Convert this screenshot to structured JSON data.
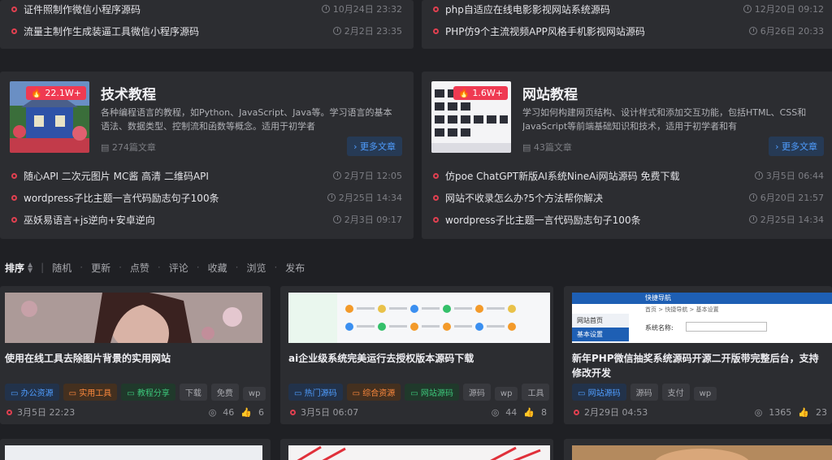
{
  "top_left": [
    {
      "title": "证件照制作微信小程序源码",
      "date": "10月24日 23:32"
    },
    {
      "title": "流量主制作生成装逼工具微信小程序源码",
      "date": "2月2日 23:35"
    }
  ],
  "top_right": [
    {
      "title": "php自适应在线电影影视网站系统源码",
      "date": "12月20日 09:12"
    },
    {
      "title": "PHP仿9个主流视频APP风格手机影视网站源码",
      "date": "6月26日 20:33"
    }
  ],
  "cat_left": {
    "hot": "22.1W+",
    "title": "技术教程",
    "desc": "各种编程语言的教程，如Python、JavaScript、Java等。学习语言的基本语法、数据类型、控制流和函数等概念。适用于初学者",
    "count": "274篇文章",
    "more": "更多文章",
    "items": [
      {
        "title": "随心API   二次元图片  MC酱  高清  二维码API",
        "date": "2月7日 12:05"
      },
      {
        "title": "wordpress子比主题一言代码励志句子100条",
        "date": "2月25日 14:34"
      },
      {
        "title": "巫妖易语言+js逆向+安卓逆向",
        "date": "2月3日 09:17"
      }
    ]
  },
  "cat_right": {
    "hot": "1.6W+",
    "title": "网站教程",
    "desc": "学习如何构建网页结构、设计样式和添加交互功能，包括HTML、CSS和JavaScript等前端基础知识和技术，适用于初学者和有",
    "count": "43篇文章",
    "more": "更多文章",
    "items": [
      {
        "title": "仿poe ChatGPT新版AI系统NineAi网站源码 免费下载",
        "date": "3月5日 06:44"
      },
      {
        "title": "网站不收录怎么办?5个方法帮你解决",
        "date": "6月20日 21:57"
      },
      {
        "title": "wordpress子比主题一言代码励志句子100条",
        "date": "2月25日 14:34"
      }
    ]
  },
  "sortbar": {
    "label": "排序",
    "options": [
      "随机",
      "更新",
      "点赞",
      "评论",
      "收藏",
      "浏览",
      "发布"
    ]
  },
  "cards": [
    {
      "title": "使用在线工具去除图片背景的实用网站",
      "tags": [
        {
          "t": "办公资源",
          "c": "blue"
        },
        {
          "t": "实用工具",
          "c": "orange"
        },
        {
          "t": "教程分享",
          "c": "green"
        },
        {
          "t": "下载",
          "c": ""
        },
        {
          "t": "免费",
          "c": ""
        },
        {
          "t": "wp",
          "c": ""
        }
      ],
      "date": "3月5日 22:23",
      "views": "46",
      "likes": "6"
    },
    {
      "title": "ai企业级系统完美运行去授权版本源码下载",
      "tags": [
        {
          "t": "热门源码",
          "c": "blue"
        },
        {
          "t": "综合资源",
          "c": "orange"
        },
        {
          "t": "网站源码",
          "c": "green"
        },
        {
          "t": "源码",
          "c": ""
        },
        {
          "t": "wp",
          "c": ""
        },
        {
          "t": "工具",
          "c": ""
        }
      ],
      "date": "3月5日 06:07",
      "views": "44",
      "likes": "8"
    },
    {
      "title": "新年PHP微信抽奖系统源码开源二开版带完整后台，支持修改开发",
      "tags": [
        {
          "t": "网站源码",
          "c": "blue"
        },
        {
          "t": "源码",
          "c": ""
        },
        {
          "t": "支付",
          "c": ""
        },
        {
          "t": "wp",
          "c": ""
        }
      ],
      "date": "2月29日 04:53",
      "views": "1365",
      "likes": "23"
    }
  ],
  "card3_img": {
    "nav_text": "快捷导航",
    "breadcrumb": "首页 > 快捷导航 > 基本设置",
    "sidebar1": "网站首页",
    "sidebar2": "基本设置",
    "field": "系统名称:"
  }
}
